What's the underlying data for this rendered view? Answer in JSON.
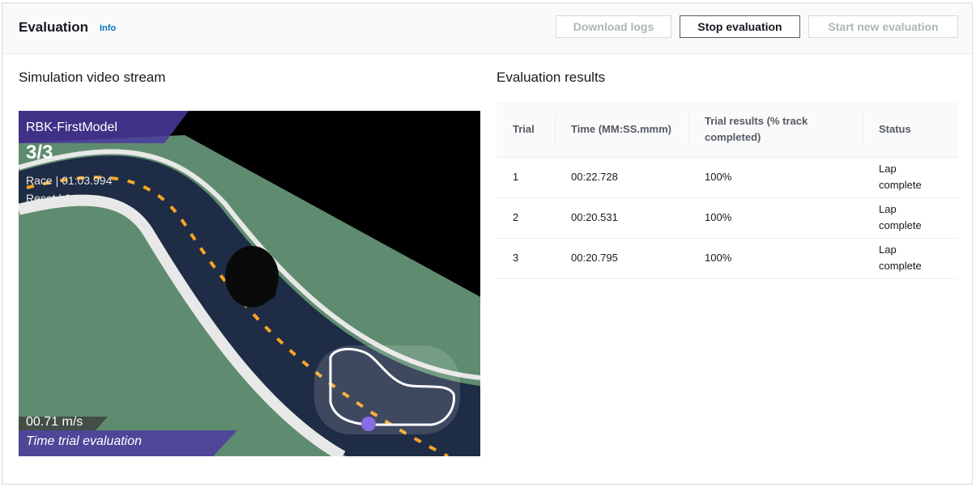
{
  "header": {
    "title": "Evaluation",
    "info": "Info",
    "buttons": {
      "download_logs": "Download logs",
      "stop_evaluation": "Stop evaluation",
      "start_new": "Start new evaluation"
    }
  },
  "left": {
    "heading": "Simulation video stream",
    "overlay": {
      "model": "RBK-FirstModel",
      "lap": "3/3",
      "race": "Race | 01:03.994",
      "reset": "Reset | 0",
      "speed": "00.71 m/s",
      "mode": "Time trial evaluation"
    }
  },
  "right": {
    "heading": "Evaluation results",
    "table": {
      "headers": [
        "Trial",
        "Time (MM:SS.mmm)",
        "Trial results (% track completed)",
        "Status"
      ],
      "rows": [
        [
          "1",
          "00:22.728",
          "100%",
          "Lap complete"
        ],
        [
          "2",
          "00:20.531",
          "100%",
          "Lap complete"
        ],
        [
          "3",
          "00:20.795",
          "100%",
          "Lap complete"
        ]
      ]
    }
  },
  "colors": {
    "accent": "#0073bb",
    "grass": "#5f8c70",
    "track": "#1f2c45",
    "center_line": "#f5a623",
    "overlay_purple": "#4b3a9e"
  }
}
